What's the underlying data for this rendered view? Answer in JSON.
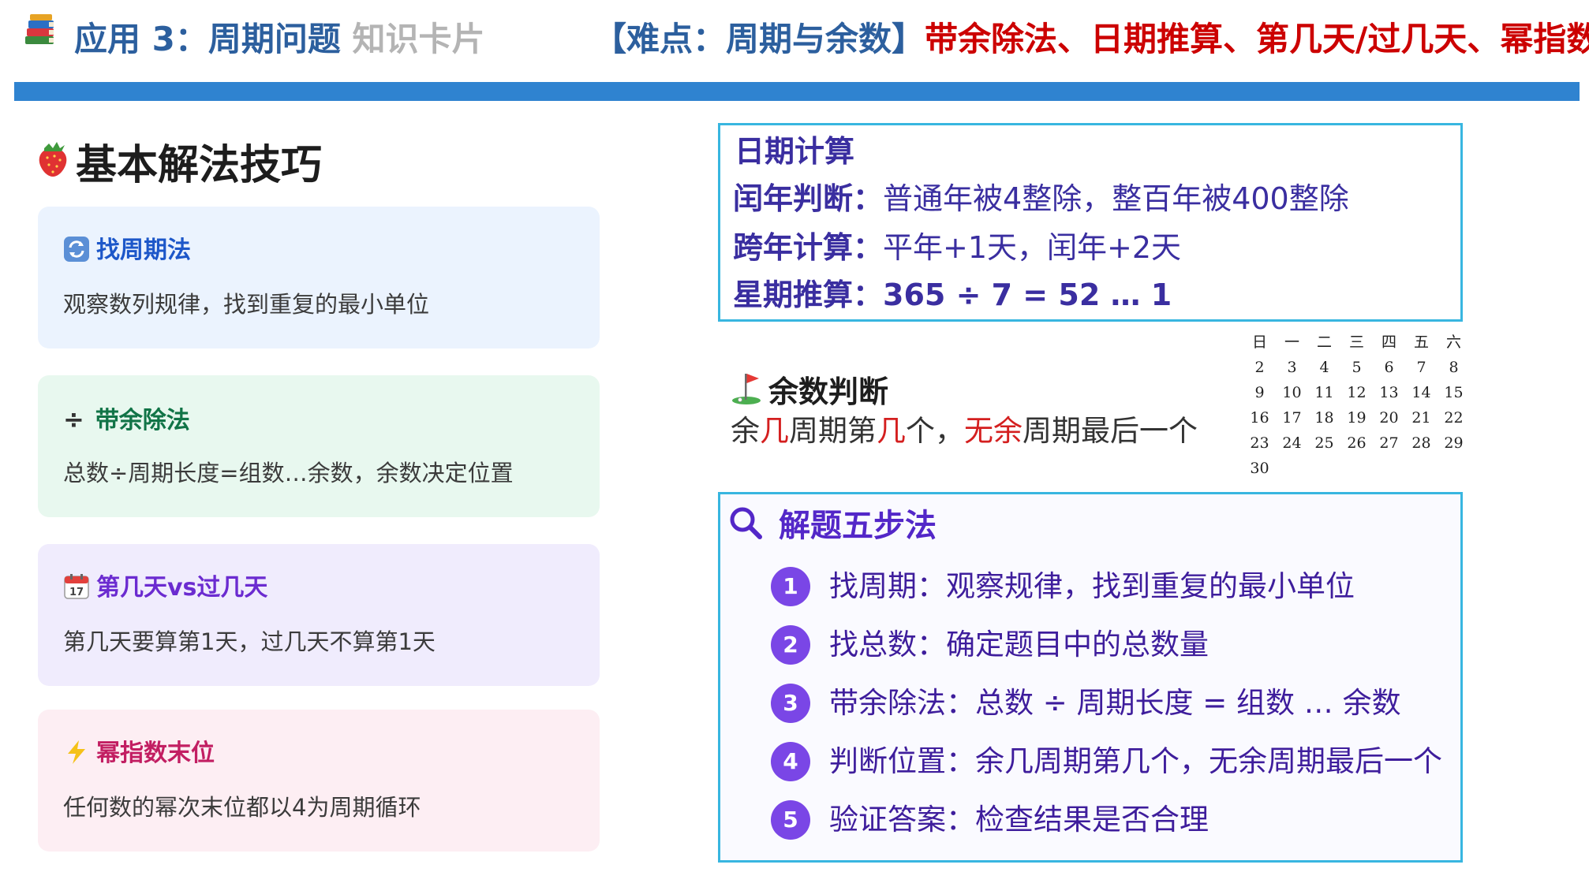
{
  "header": {
    "title_main": "应用 3：周期问题",
    "title_sub": "知识卡片",
    "difficulty_tag": "【难点：周期与余数】",
    "difficulty_items": "带余除法、日期推算、第几天/过几天、幂指数",
    "icon": "books-icon"
  },
  "left": {
    "title": "基本解法技巧",
    "icon": "strawberry-icon",
    "cards": [
      {
        "icon": "cycle-arrows-icon",
        "symbol": "",
        "title": "找周期法",
        "text": "观察数列规律，找到重复的最小单位",
        "color": "#1d57c9"
      },
      {
        "icon": "division-icon",
        "symbol": "÷",
        "title": "带余除法",
        "text": "总数÷周期长度=组数…余数，余数决定位置",
        "color": "#117447"
      },
      {
        "icon": "calendar-icon",
        "symbol": "",
        "title": "第几天vs过几天",
        "text": "第几天要算第1天，过几天不算第1天",
        "color": "#6b2bd0"
      },
      {
        "icon": "lightning-icon",
        "symbol": "",
        "title": "幂指数末位",
        "text": "任何数的幂次末位都以4为周期循环",
        "color": "#c21e62"
      }
    ]
  },
  "date_calc": {
    "title": "日期计算",
    "rows": [
      {
        "key": "闰年判断：",
        "value": "普通年被4整除，整百年被400整除",
        "bold": false
      },
      {
        "key": "跨年计算：",
        "value": "平年+1天，闰年+2天",
        "bold": false
      },
      {
        "key": "星期推算：",
        "value": "365 ÷ 7 = 52 … 1",
        "bold": true
      }
    ]
  },
  "remainder": {
    "title": "余数判断",
    "icon": "golf-flag-icon",
    "p1": "余",
    "r1": "几",
    "p2": "周期第",
    "r2": "几",
    "p3": "个，",
    "r3": "无余",
    "p4": "周期最后一个"
  },
  "calendar": {
    "headers": [
      "日",
      "一",
      "二",
      "三",
      "四",
      "五",
      "六"
    ],
    "weeks": [
      [
        "2",
        "3",
        "4",
        "5",
        "6",
        "7",
        "8"
      ],
      [
        "9",
        "10",
        "11",
        "12",
        "13",
        "14",
        "15"
      ],
      [
        "16",
        "17",
        "18",
        "19",
        "20",
        "21",
        "22"
      ],
      [
        "23",
        "24",
        "25",
        "26",
        "27",
        "28",
        "29"
      ],
      [
        "30",
        "",
        "",
        "",
        "",
        "",
        ""
      ]
    ]
  },
  "steps": {
    "title": "解题五步法",
    "icon": "magnifier-icon",
    "items": [
      {
        "num": "1",
        "text": "找周期：观察规律，找到重复的最小单位"
      },
      {
        "num": "2",
        "text": "找总数：确定题目中的总数量"
      },
      {
        "num": "3",
        "text": "带余除法：总数 ÷ 周期长度 = 组数 … 余数"
      },
      {
        "num": "4",
        "text": "判断位置：余几周期第几个，无余周期最后一个"
      },
      {
        "num": "5",
        "text": "验证答案：检查结果是否合理"
      }
    ]
  }
}
